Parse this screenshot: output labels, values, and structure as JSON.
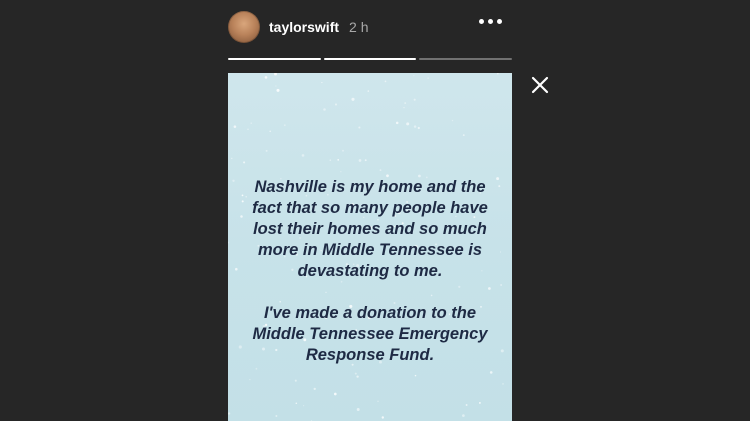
{
  "header": {
    "username": "taylorswift",
    "time": "2 h"
  },
  "progress": [
    1,
    1,
    0
  ],
  "story": {
    "paragraphs": [
      "Nashville is my home and the fact that so many people have lost their homes and so much more in Middle Tennessee is devastating to me.",
      "I've made a donation to the Middle Tennessee Emergency Response Fund."
    ]
  },
  "icons": {
    "more": "more-options-icon",
    "close": "close-icon"
  },
  "colors": {
    "background": "#262626",
    "story_bg": "#c7e2e9",
    "story_text": "#1e2a44"
  }
}
